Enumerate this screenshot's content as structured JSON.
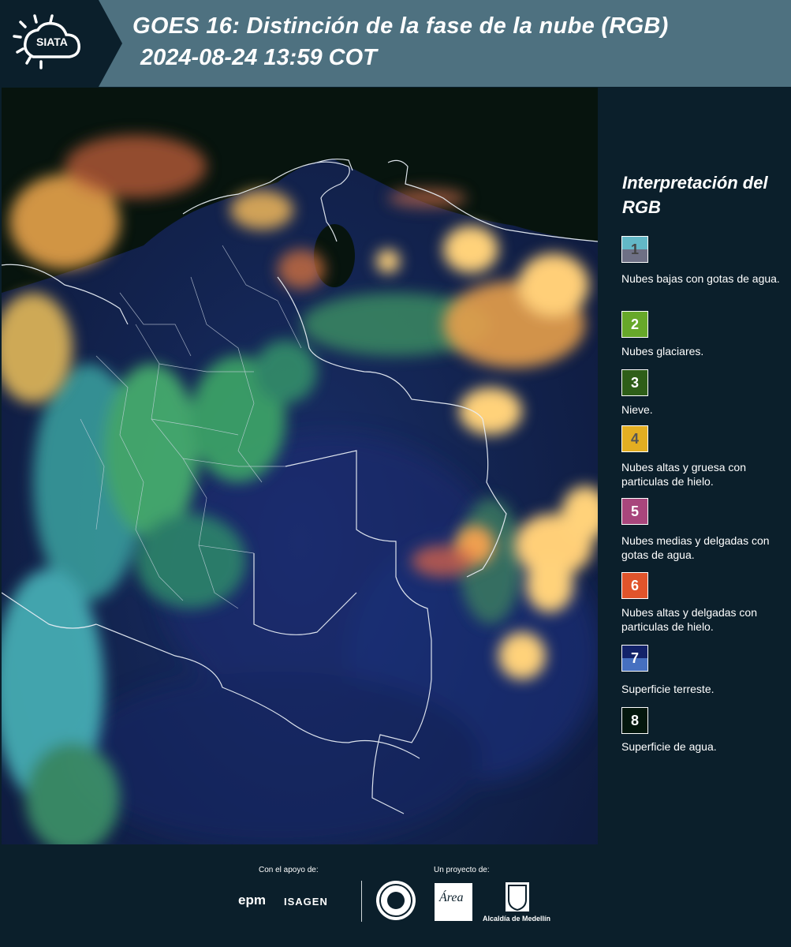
{
  "header": {
    "logo_text": "SIATA",
    "title": "GOES 16: Distinción de la fase de la nube (RGB)",
    "datetime": "2024-08-24 13:59 COT"
  },
  "legend": {
    "title": "Interpretación del RGB",
    "items": [
      {
        "number": "1",
        "label": "Nubes bajas con gotas de agua.",
        "color_top": "#63b8c7",
        "color_bottom": "#6e7085"
      },
      {
        "number": "2",
        "label": "Nubes glaciares.",
        "color": "#67a82a"
      },
      {
        "number": "3",
        "label": "Nieve.",
        "color": "#2e5e18"
      },
      {
        "number": "4",
        "label": "Nubes altas y gruesa con particulas de hielo.",
        "color": "#e3ae22"
      },
      {
        "number": "5",
        "label": "Nubes medias y delgadas con gotas de agua.",
        "color": "#a8467c"
      },
      {
        "number": "6",
        "label": "Nubes altas y delgadas con particulas de hielo.",
        "color": "#e0542b"
      },
      {
        "number": "7",
        "label": "Superficie terreste.",
        "color_top": "#13236a",
        "color_bottom": "#4670c0"
      },
      {
        "number": "8",
        "label": "Superficie de agua.",
        "color": "#04170d"
      }
    ]
  },
  "footer": {
    "support_label": "Con el apoyo de:",
    "project_label": "Un proyecto de:",
    "epm": "epm",
    "isagen": "ISAGEN",
    "area_text": "Área",
    "alcaldia": "Alcaldía de Medellín"
  }
}
